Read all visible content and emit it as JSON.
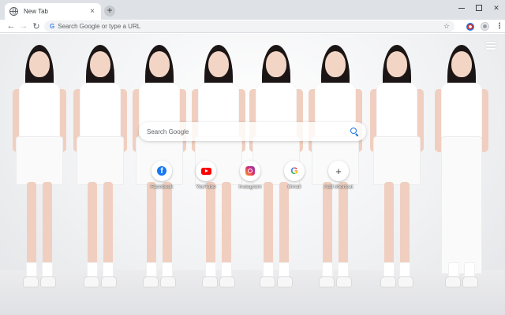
{
  "tabs": [
    {
      "title": "New Tab",
      "close": "×"
    }
  ],
  "new_tab_symbol": "+",
  "window_controls": {
    "close": "✕"
  },
  "toolbar": {
    "back": "←",
    "forward": "→",
    "reload": "↻",
    "omnibox_icon": "G",
    "omnibox_placeholder": "Search Google or type a URL",
    "bookmark": "☆",
    "menu": "⋮"
  },
  "ntp": {
    "search_placeholder": "Search Google",
    "shortcuts": [
      {
        "label": "Facebook",
        "icon": "facebook-icon"
      },
      {
        "label": "YouTube",
        "icon": "youtube-icon"
      },
      {
        "label": "Instagram",
        "icon": "instagram-icon"
      },
      {
        "label": "Gmail",
        "icon": "google-icon"
      },
      {
        "label": "Add shortcut",
        "icon": "add-icon"
      }
    ]
  },
  "colors": {
    "accent": "#1a73e8",
    "tabstrip": "#dee1e6",
    "omnibox": "#f1f3f4"
  }
}
